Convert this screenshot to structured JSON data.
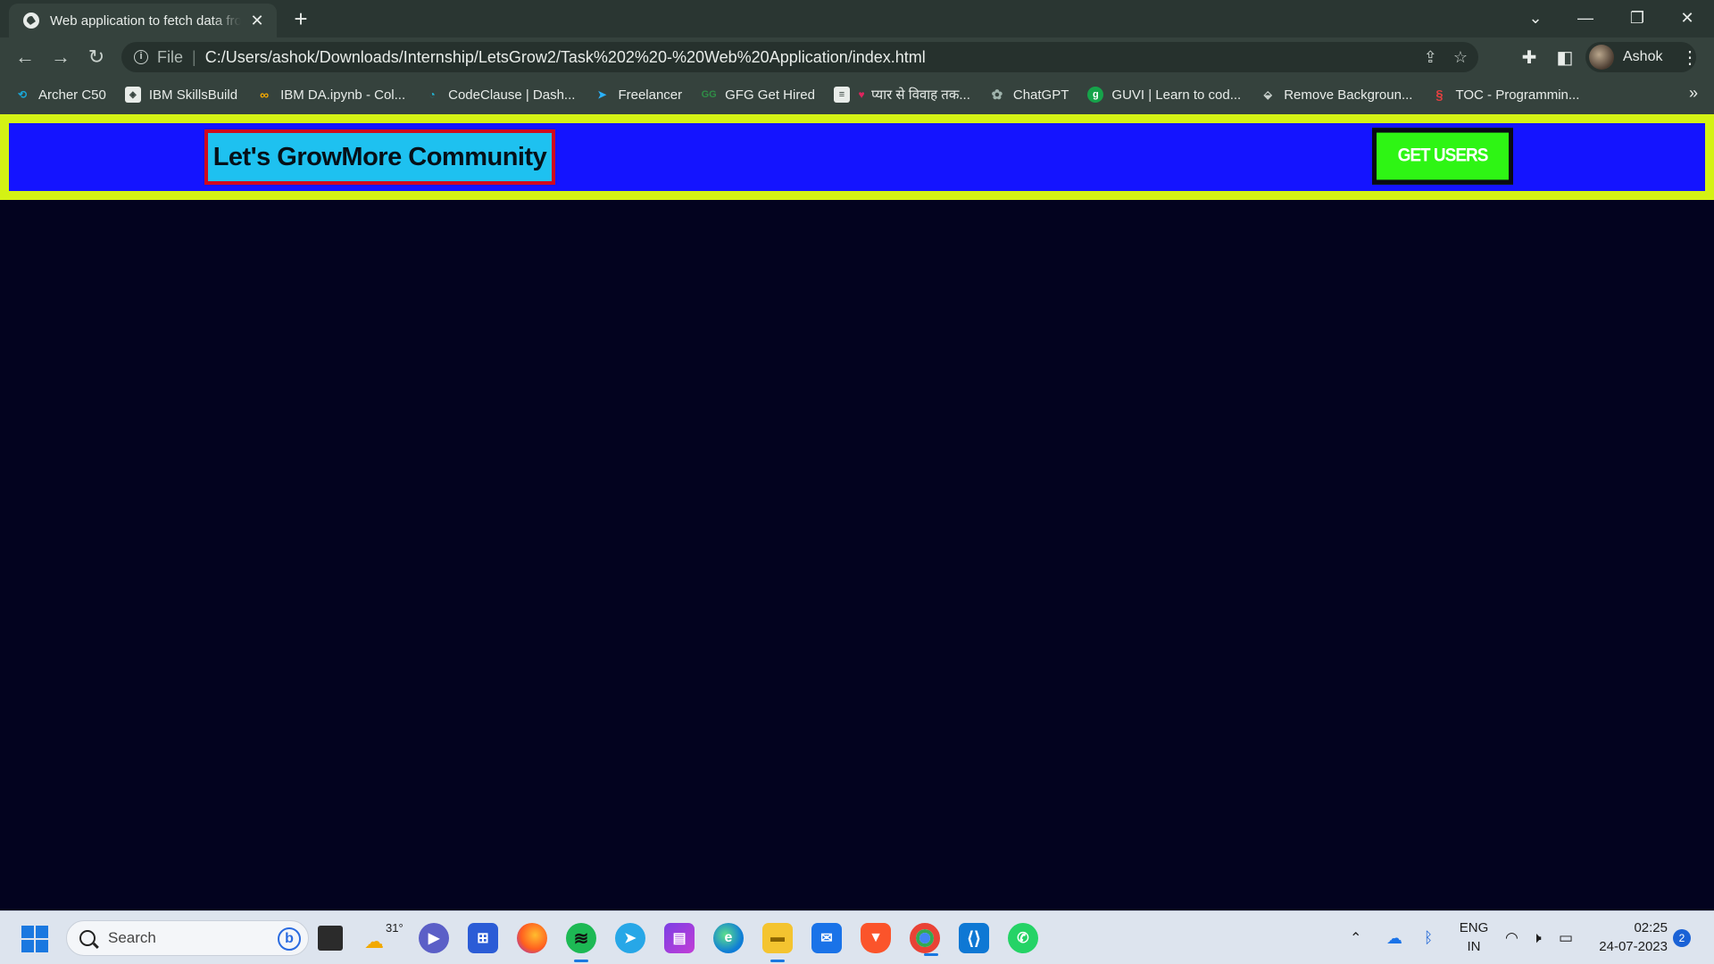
{
  "browser": {
    "tab_title": "Web application to fetch data from API",
    "new_tab_symbol": "+",
    "url_scheme": "File",
    "url": "C:/Users/ashok/Downloads/Internship/LetsGrow2/Task%202%20-%20Web%20Application/index.html",
    "profile_name": "Ashok",
    "bookmarks": [
      {
        "label": "Archer C50",
        "icon": "tp-link-icon",
        "color": "#1aa6d6"
      },
      {
        "label": "IBM SkillsBuild",
        "icon": "ibm-icon",
        "color": "#e8ece9"
      },
      {
        "label": "IBM DA.ipynb - Col...",
        "icon": "colab-icon",
        "color": "#f9ab00"
      },
      {
        "label": "CodeClause | Dash...",
        "icon": "codeclause-icon",
        "color": "#22b8d8"
      },
      {
        "label": "Freelancer",
        "icon": "freelancer-icon",
        "color": "#29b2fe"
      },
      {
        "label": "GFG Get Hired",
        "icon": "gfg-icon",
        "color": "#2f8d46"
      },
      {
        "label": "प्यार से विवाह तक...",
        "icon": "heart-icon",
        "color": "#e0245e"
      },
      {
        "label": "ChatGPT",
        "icon": "chatgpt-icon",
        "color": "#9fb3ac"
      },
      {
        "label": "GUVI | Learn to cod...",
        "icon": "guvi-icon",
        "color": "#16a34a"
      },
      {
        "label": "Remove Backgroun...",
        "icon": "removebg-icon",
        "color": "#c9d1cd"
      },
      {
        "label": "TOC - Programmin...",
        "icon": "toc-icon",
        "color": "#e04040"
      }
    ],
    "more_bookmarks_symbol": "»"
  },
  "page": {
    "brand_title": "Let's GrowMore Community",
    "get_users_label": "GET USERS",
    "colors": {
      "background": "#03031f",
      "navbar": "#1414ff",
      "navbar_border": "#d4f214",
      "brand_bg": "#1ec1f0",
      "brand_border": "#d00a1e",
      "button_bg": "#2ef514"
    }
  },
  "taskbar": {
    "search_placeholder": "Search",
    "weather_temp": "31°",
    "lang_line1": "ENG",
    "lang_line2": "IN",
    "time": "02:25",
    "date": "24-07-2023",
    "notification_count": "2"
  }
}
